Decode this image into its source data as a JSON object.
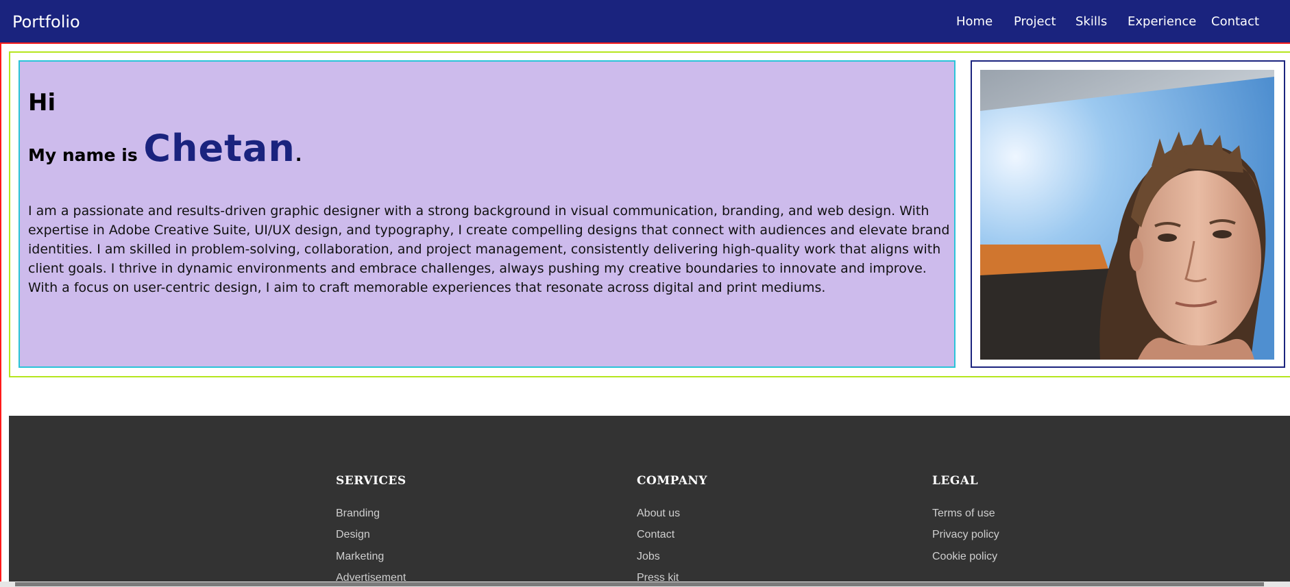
{
  "navbar": {
    "brand": "Portfolio",
    "links": [
      "Home",
      "Project",
      "Skills",
      "Experience",
      "Contact"
    ],
    "background": "#1a237e"
  },
  "intro": {
    "greeting": "Hi",
    "name_prefix": "My name is ",
    "name": "Chetan",
    "name_suffix": ".",
    "bio": "I am a passionate and results-driven graphic designer with a strong background in visual communication, branding, and web design. With expertise in Adobe Creative Suite, UI/UX design, and typography, I create compelling designs that connect with audiences and elevate brand identities. I am skilled in problem-solving, collaboration, and project management, consistently delivering high-quality work that aligns with client goals. I thrive in dynamic environments and embrace challenges, always pushing my creative boundaries to innovate and improve. With a focus on user-centric design, I aim to craft memorable experiences that resonate across digital and print mediums.",
    "background": "#cdbbec",
    "accent": "#1a237e"
  },
  "profile_photo": {
    "icon": "profile-photo"
  },
  "footer": {
    "columns": [
      {
        "heading": "SERVICES",
        "links": [
          "Branding",
          "Design",
          "Marketing",
          "Advertisement"
        ]
      },
      {
        "heading": "COMPANY",
        "links": [
          "About us",
          "Contact",
          "Jobs",
          "Press kit"
        ]
      },
      {
        "heading": "LEGAL",
        "links": [
          "Terms of use",
          "Privacy policy",
          "Cookie policy"
        ]
      }
    ],
    "background": "#333333"
  }
}
